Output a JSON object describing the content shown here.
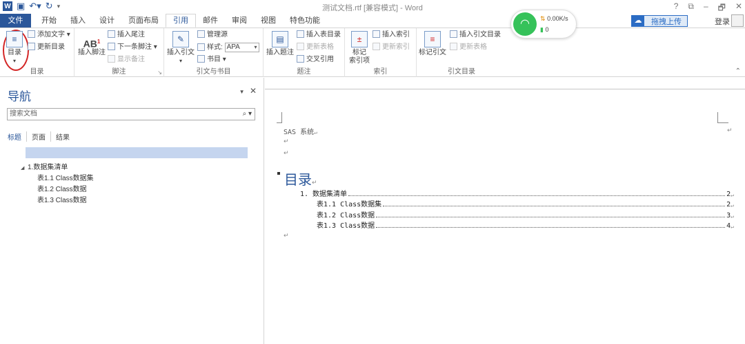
{
  "titlebar": {
    "title": "测试文档.rtf [兼容模式] - Word",
    "controls": [
      "?",
      "⧉",
      "–",
      "🗗",
      "✕"
    ]
  },
  "tabs": {
    "file": "文件",
    "items": [
      "开始",
      "插入",
      "设计",
      "页面布局",
      "引用",
      "邮件",
      "审阅",
      "视图",
      "特色功能"
    ],
    "active": "引用"
  },
  "account": {
    "upload": "拖拽上传",
    "login": "登录"
  },
  "wifi": {
    "speed": "0.00K/s",
    "count": "0"
  },
  "ribbon": {
    "toc": {
      "big": "目录",
      "add_text": "添加文字",
      "update_toc": "更新目录",
      "label": "目录"
    },
    "footnote": {
      "insert_footnote": "插入脚注",
      "insert_endnote": "插入尾注",
      "next_footnote": "下一条脚注",
      "show_notes": "显示备注",
      "label": "脚注"
    },
    "citation": {
      "insert_citation": "插入引文",
      "manage_sources": "管理源",
      "style_label": "样式:",
      "style_value": "APA",
      "bibliography": "书目",
      "label": "引文与书目"
    },
    "caption": {
      "insert_caption": "插入题注",
      "insert_table_figures": "插入表目录",
      "update_table": "更新表格",
      "cross_reference": "交叉引用",
      "label": "题注"
    },
    "index": {
      "mark_entry": "标记\n索引项",
      "insert_index": "插入索引",
      "update_index": "更新索引",
      "label": "索引"
    },
    "authorities": {
      "mark_citation": "标记引文",
      "insert_toa": "插入引文目录",
      "update_table": "更新表格",
      "label": "引文目录"
    }
  },
  "nav": {
    "title": "导航",
    "search_placeholder": "搜索文档",
    "tabs": [
      "标题",
      "页面",
      "结果"
    ],
    "tree": [
      {
        "level": 1,
        "text": "1.数据集清单"
      },
      {
        "level": 2,
        "text": "表1.1 Class数据集"
      },
      {
        "level": 2,
        "text": "表1.2 Class数据"
      },
      {
        "level": 2,
        "text": "表1.3 Class数据"
      }
    ]
  },
  "document": {
    "header": "SAS 系统",
    "heading": "目录",
    "toc": [
      {
        "text": "1. 数据集清单",
        "page": "2"
      },
      {
        "text": "表1.1 Class数据集",
        "page": "2"
      },
      {
        "text": "表1.2 Class数据",
        "page": "3"
      },
      {
        "text": "表1.3 Class数据",
        "page": "4"
      }
    ]
  }
}
